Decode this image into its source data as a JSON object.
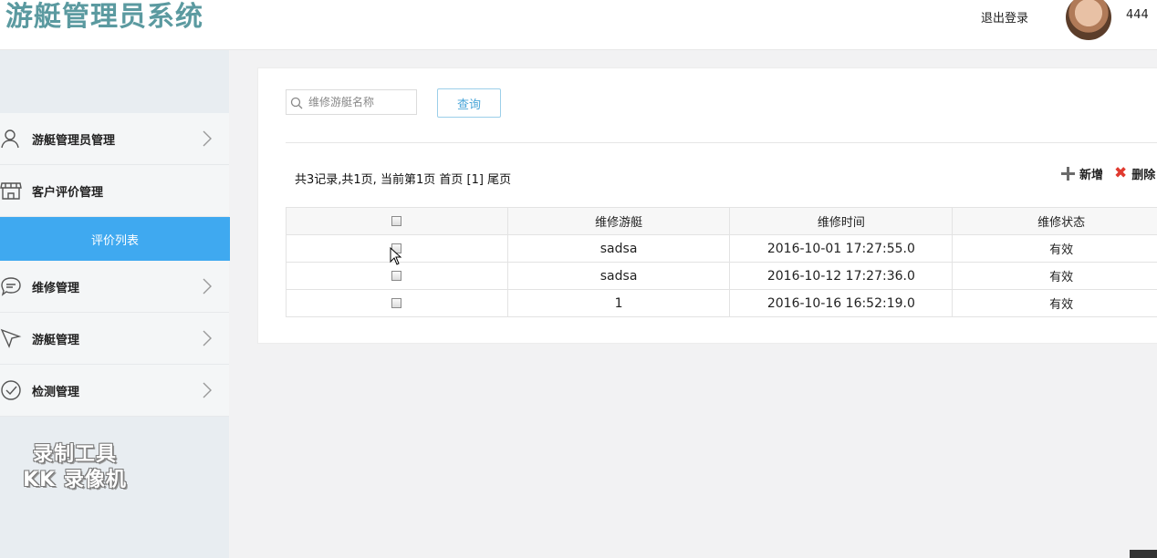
{
  "header": {
    "title": "游艇管理员系统",
    "logout": "退出登录",
    "username": "444"
  },
  "sidebar": {
    "items": [
      {
        "label": "游艇管理员管理",
        "icon": "user-icon"
      },
      {
        "label": "客户评价管理",
        "icon": "store-icon"
      },
      {
        "label": "维修管理",
        "icon": "chat-bubble-icon"
      },
      {
        "label": "游艇管理",
        "icon": "cursor-arrow-icon"
      },
      {
        "label": "检测管理",
        "icon": "check-circle-icon"
      }
    ],
    "active_sub": "评价列表"
  },
  "watermark": {
    "line1": "录制工具",
    "line2": "KK 录像机"
  },
  "search": {
    "placeholder": "维修游艇名称",
    "value": "",
    "button": "查询"
  },
  "pager": {
    "summary": "共3记录,共1页, 当前第1页",
    "first": "首页",
    "current": "[1]",
    "last": "尾页"
  },
  "toolbar": {
    "add": "新增",
    "delete": "删除"
  },
  "table": {
    "columns": [
      "维修游艇",
      "维修时间",
      "维修状态"
    ],
    "rows": [
      {
        "boat": "sadsa",
        "time": "2016-10-01 17:27:55.0",
        "status": "有效"
      },
      {
        "boat": "sadsa",
        "time": "2016-10-12 17:27:36.0",
        "status": "有效"
      },
      {
        "boat": "1",
        "time": "2016-10-16 16:52:19.0",
        "status": "有效"
      }
    ]
  },
  "colors": {
    "accent": "#3fa9f0",
    "title": "#5b9aa0",
    "delete": "#e03a2f"
  }
}
